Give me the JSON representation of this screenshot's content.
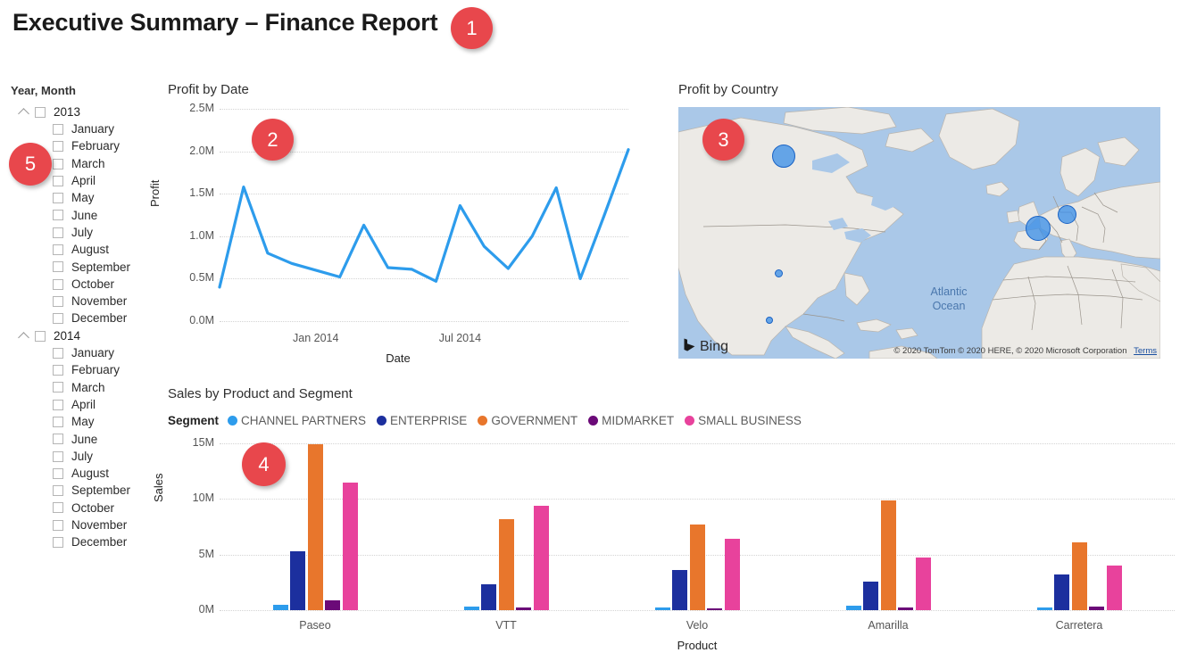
{
  "header": {
    "title": "Executive Summary – Finance Report"
  },
  "badges": [
    {
      "id": "badge-1",
      "label": "1"
    },
    {
      "id": "badge-2",
      "label": "2"
    },
    {
      "id": "badge-3",
      "label": "3"
    },
    {
      "id": "badge-4",
      "label": "4"
    },
    {
      "id": "badge-5",
      "label": "5"
    }
  ],
  "slicer": {
    "title": "Year, Month",
    "groups": [
      {
        "year": "2013",
        "months": [
          "January",
          "February",
          "March",
          "April",
          "May",
          "June",
          "July",
          "August",
          "September",
          "October",
          "November",
          "December"
        ]
      },
      {
        "year": "2014",
        "months": [
          "January",
          "February",
          "March",
          "April",
          "May",
          "June",
          "July",
          "August",
          "September",
          "October",
          "November",
          "December"
        ]
      }
    ]
  },
  "map": {
    "title": "Profit by Country",
    "ocean_label": "Atlantic\nOcean",
    "brand": "Bing",
    "attribution": "© 2020 TomTom © 2020 HERE, © 2020 Microsoft Corporation",
    "terms": "Terms",
    "bubbles": [
      {
        "name": "canada",
        "x": 118,
        "y": 55,
        "size": 26
      },
      {
        "name": "united-states",
        "x": 112,
        "y": 186,
        "size": 9
      },
      {
        "name": "mexico",
        "x": 102,
        "y": 239,
        "size": 8
      },
      {
        "name": "germany",
        "x": 435,
        "y": 120,
        "size": 21
      },
      {
        "name": "france",
        "x": 403,
        "y": 136,
        "size": 28
      }
    ]
  },
  "chart_data": [
    {
      "name": "profit-by-date",
      "type": "line",
      "title": "Profit by Date",
      "xlabel": "Date",
      "ylabel": "Profit",
      "ytick_labels": [
        "0.0M",
        "0.5M",
        "1.0M",
        "1.5M",
        "2.0M",
        "2.5M"
      ],
      "ylim": [
        0,
        2500000
      ],
      "xtick_labels": [
        "Jan 2014",
        "Jul 2014"
      ],
      "grid": true,
      "series_color": "#2d9cec",
      "x": [
        "Sep 2013",
        "Oct 2013",
        "Nov 2013",
        "Dec 2013",
        "Jan 2014",
        "Feb 2014",
        "Mar 2014",
        "Apr 2014",
        "May 2014",
        "Jun 2014",
        "Jul 2014",
        "Aug 2014",
        "Sep 2014",
        "Oct 2014",
        "Nov 2014",
        "Dec 2014",
        "Jan 2015",
        "Feb 2015"
      ],
      "values": [
        0.4,
        1.58,
        0.8,
        0.68,
        0.6,
        0.52,
        1.13,
        0.63,
        0.61,
        0.47,
        1.36,
        0.88,
        0.62,
        1.0,
        1.57,
        0.5,
        1.25,
        2.02
      ],
      "value_unit": "M"
    },
    {
      "name": "sales-by-product-and-segment",
      "type": "bar",
      "title": "Sales by Product and Segment",
      "legend_caption": "Segment",
      "xlabel": "Product",
      "ylabel": "Sales",
      "ytick_labels": [
        "0M",
        "5M",
        "10M",
        "15M"
      ],
      "ylim": [
        0,
        15000000
      ],
      "grid": true,
      "legend_position": "top",
      "categories": [
        "Paseo",
        "VTT",
        "Velo",
        "Amarilla",
        "Carretera"
      ],
      "series": [
        {
          "name": "CHANNEL PARTNERS",
          "color": "#2d9cec",
          "values": [
            0.5,
            0.32,
            0.22,
            0.38,
            0.28
          ]
        },
        {
          "name": "ENTERPRISE",
          "color": "#1c2f9e",
          "values": [
            5.3,
            2.3,
            3.6,
            2.6,
            3.2
          ]
        },
        {
          "name": "GOVERNMENT",
          "color": "#e8762c",
          "values": [
            14.9,
            8.2,
            7.7,
            9.9,
            6.1
          ]
        },
        {
          "name": "MIDMARKET",
          "color": "#6b0a78",
          "values": [
            0.9,
            0.28,
            0.18,
            0.25,
            0.32
          ]
        },
        {
          "name": "SMALL BUSINESS",
          "color": "#e8429c",
          "values": [
            11.5,
            9.4,
            6.4,
            4.7,
            4.0
          ]
        }
      ],
      "value_unit": "M"
    }
  ]
}
